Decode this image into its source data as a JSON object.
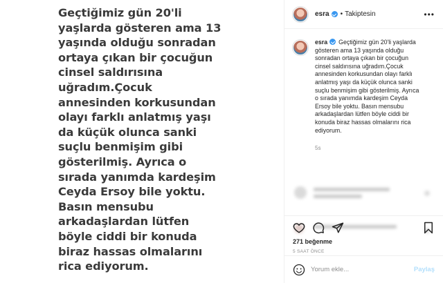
{
  "story": {
    "lines": [
      "Geçtiğimiz gün 20'li",
      "yaşlarda gösteren ama 13",
      "yaşında olduğu sonradan",
      "ortaya çıkan bir çocuğun",
      "cinsel saldırısına",
      "uğradım.Çocuk",
      "annesinden korkusundan",
      "olayı farklı anlatmış yaşı",
      "da küçük olunca sanki",
      "suçlu benmişim gibi",
      "gösterilmiş. Ayrıca o",
      "sırada yanımda kardeşim",
      "Ceyda Ersoy bile yoktu.",
      "Basın mensubu",
      "arkadaşlardan lütfen",
      "böyle ciddi bir konuda",
      "biraz hassas olmalarını",
      "rica ediyorum."
    ]
  },
  "header": {
    "username": "esra",
    "separator": "•",
    "follow_status": "Takiptesin",
    "more": "•••"
  },
  "caption": {
    "username": "esra",
    "lines": [
      "Geçtiğimiz gün 20'li yaşlarda",
      "gösteren ama 13 yaşında olduğu",
      "sonradan ortaya çıkan bir çocuğun",
      "cinsel saldırısına uğradım.Çocuk",
      "annesinden korkusundan olayı farklı",
      "anlatmış yaşı da küçük olunca sanki",
      "suçlu benmişim gibi gösterilmiş. Ayrıca",
      "o sırada yanımda kardeşim Ceyda",
      "Ersoy bile yoktu. Basın mensubu",
      "arkadaşlardan lütfen böyle ciddi bir",
      "konuda biraz hassas olmalarını rica",
      "ediyorum."
    ],
    "time": "5s"
  },
  "icons": {
    "like": "heart-icon",
    "comment": "comment-icon",
    "share": "share-icon",
    "save": "bookmark-icon",
    "emoji": "smiley-icon"
  },
  "engagement": {
    "likes": "271 beğenme",
    "time_ago": "5 SAAT ÖNCE"
  },
  "comment_box": {
    "placeholder": "Yorum ekle...",
    "post_label": "Paylaş"
  },
  "colors": {
    "verified": "#3897f0",
    "post_disabled": "#b2dffc",
    "muted": "#8e8e8e"
  }
}
